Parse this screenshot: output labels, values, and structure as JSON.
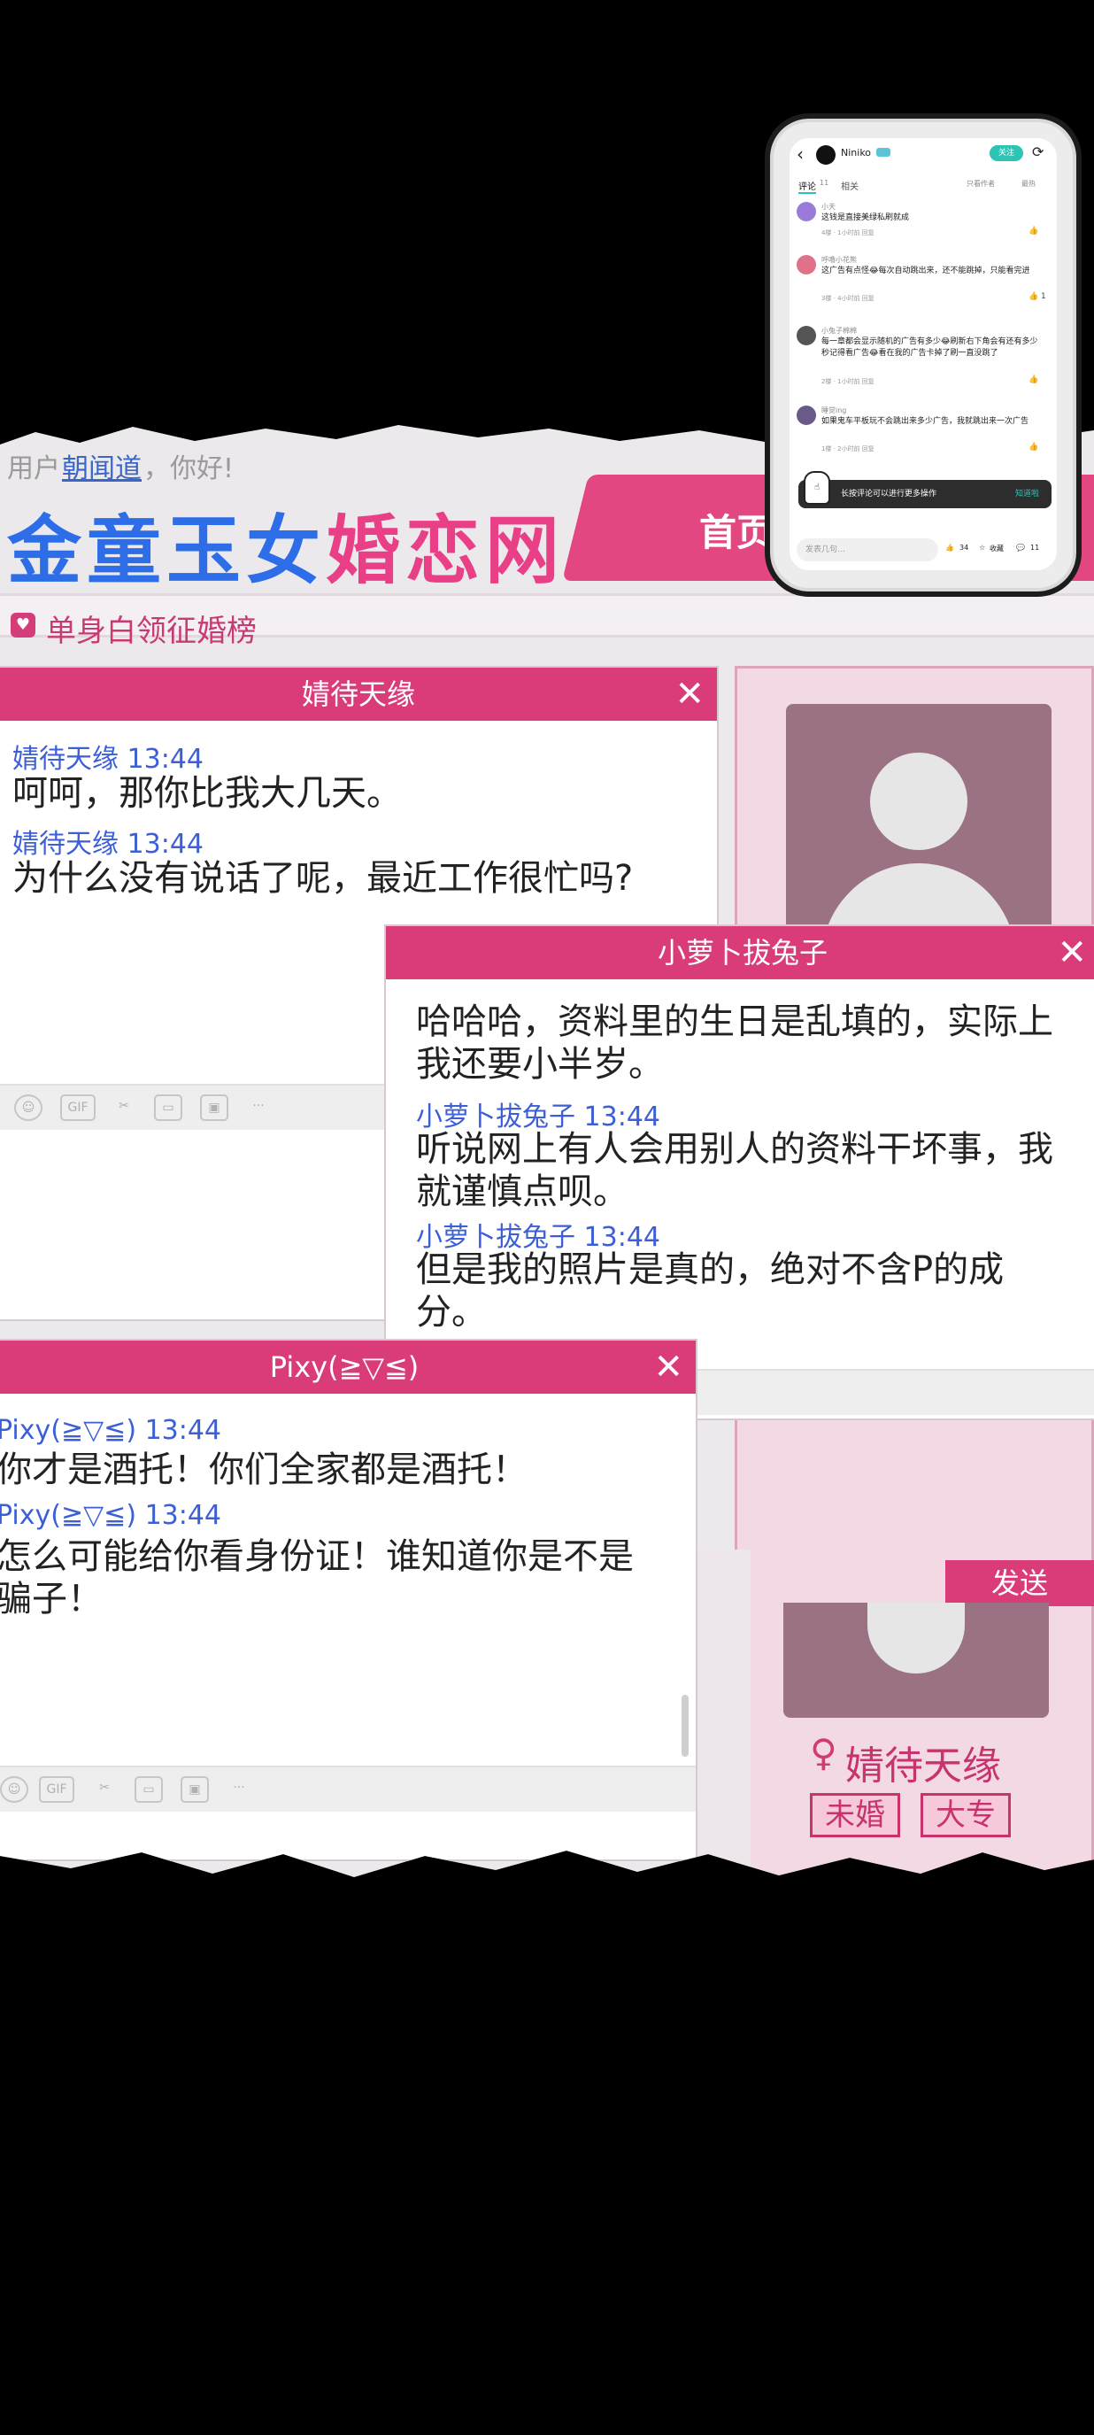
{
  "site": {
    "greeting_prefix": "用户",
    "username": "朝闻道",
    "greeting_suffix": "，你好!",
    "logo_blue": "金童玉女",
    "logo_pink": "婚恋网",
    "home_tab": "首页",
    "ranking_label": "单身白领征婚榜"
  },
  "chats": [
    {
      "title": "婧待天缘",
      "messages": [
        {
          "meta": "婧待天缘 13:44",
          "text": "呵呵，那你比我大几天。"
        },
        {
          "meta": "婧待天缘 13:44",
          "text": "为什么没有说话了呢，最近工作很忙吗?"
        }
      ]
    },
    {
      "title": "小萝卜拔兔子",
      "messages": [
        {
          "meta": "",
          "text": "哈哈哈，资料里的生日是乱填的，实际上我还要小半岁。"
        },
        {
          "meta": "小萝卜拔兔子 13:44",
          "text": "听说网上有人会用别人的资料干坏事，我就谨慎点呗。"
        },
        {
          "meta": "小萝卜拔兔子 13:44",
          "text": "但是我的照片是真的，绝对不含P的成分。"
        }
      ]
    },
    {
      "title": "Pixy(≧▽≦)",
      "messages": [
        {
          "meta": "Pixy(≧▽≦) 13:44",
          "text": "你才是酒托！你们全家都是酒托！"
        },
        {
          "meta": "Pixy(≧▽≦) 13:44",
          "text": "怎么可能给你看身份证！谁知道你是不是骗子！"
        }
      ]
    }
  ],
  "close_glyph": "✕",
  "toolbar": {
    "emoji": "☺",
    "gif": "GIF",
    "cut": "✂",
    "folder": "▭",
    "image": "▣",
    "more": "···"
  },
  "send_label": "发送",
  "profile": {
    "gender": "♀",
    "name": "婧待天缘",
    "tags": [
      "未婚",
      "大专"
    ]
  },
  "phone": {
    "back": "‹",
    "author": "Niniko",
    "follow": "关注",
    "share": "⟳",
    "tab_comments": "评论",
    "tab_comments_count": "11",
    "tab_related": "相关",
    "sort_hint": "只看作者",
    "sort_order": "最热",
    "comments": [
      {
        "name": "小天",
        "text": "这钱是直接美绿私刷就成",
        "meta": "4楼 · 1小时前 回复",
        "likes": ""
      },
      {
        "name": "呼噜小花熊",
        "text": "这广告有点怪😂每次自动跳出来，还不能跳掉，只能看完进",
        "meta": "3楼 · 4小时前 回复",
        "likes": "1"
      },
      {
        "name": "小兔子棉棉",
        "text": "每一章都会显示随机的广告有多少😂刷新右下角会有还有多少秒记得看广告😂看在我的广告卡掉了刷一直没跳了",
        "meta": "2楼 · 1小时前 回复",
        "likes": ""
      },
      {
        "name": "睡觉ing",
        "text": "如果鬼车平板玩不会跳出来多少广告，我就跳出来一次广告",
        "meta": "1楼 · 2小时前 回复",
        "likes": ""
      }
    ],
    "toast": "长按评论可以进行更多操作",
    "toast_ok": "知道啦",
    "input_placeholder": "发表几句…",
    "like_count": "34",
    "collect_label": "收藏",
    "comment_count": "11"
  }
}
